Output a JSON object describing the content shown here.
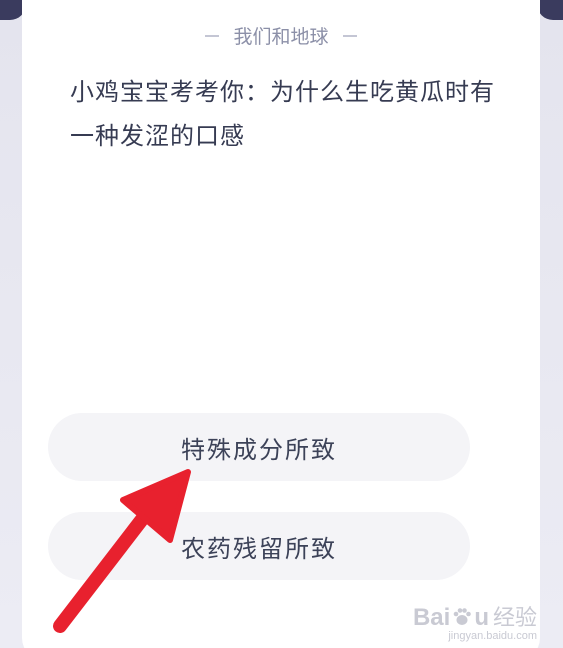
{
  "header": {
    "section_title": "我们和地球"
  },
  "question": {
    "text": "小鸡宝宝考考你：为什么生吃黄瓜时有一种发涩的口感"
  },
  "options": [
    {
      "label": "特殊成分所致"
    },
    {
      "label": "农药残留所致"
    }
  ],
  "annotation": {
    "arrow_color": "#e8212e"
  },
  "watermark": {
    "brand_prefix": "Bai",
    "brand_suffix": "u",
    "sub": "经验",
    "url": "jingyan.baidu.com"
  },
  "colors": {
    "accent_dark": "#3a3b5e",
    "card_bg": "#ffffff",
    "option_bg": "#f4f4f7",
    "text_primary": "#363b52",
    "text_muted": "#8c90a8"
  }
}
